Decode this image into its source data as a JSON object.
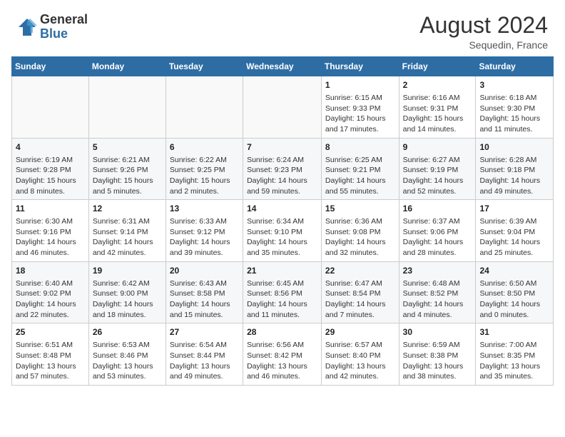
{
  "header": {
    "logo_general": "General",
    "logo_blue": "Blue",
    "month_year": "August 2024",
    "location": "Sequedin, France"
  },
  "calendar": {
    "days_of_week": [
      "Sunday",
      "Monday",
      "Tuesday",
      "Wednesday",
      "Thursday",
      "Friday",
      "Saturday"
    ],
    "weeks": [
      [
        {
          "day": "",
          "empty": true
        },
        {
          "day": "",
          "empty": true
        },
        {
          "day": "",
          "empty": true
        },
        {
          "day": "",
          "empty": true
        },
        {
          "day": "1",
          "lines": [
            "Sunrise: 6:15 AM",
            "Sunset: 9:33 PM",
            "Daylight: 15 hours",
            "and 17 minutes."
          ]
        },
        {
          "day": "2",
          "lines": [
            "Sunrise: 6:16 AM",
            "Sunset: 9:31 PM",
            "Daylight: 15 hours",
            "and 14 minutes."
          ]
        },
        {
          "day": "3",
          "lines": [
            "Sunrise: 6:18 AM",
            "Sunset: 9:30 PM",
            "Daylight: 15 hours",
            "and 11 minutes."
          ]
        }
      ],
      [
        {
          "day": "4",
          "lines": [
            "Sunrise: 6:19 AM",
            "Sunset: 9:28 PM",
            "Daylight: 15 hours",
            "and 8 minutes."
          ]
        },
        {
          "day": "5",
          "lines": [
            "Sunrise: 6:21 AM",
            "Sunset: 9:26 PM",
            "Daylight: 15 hours",
            "and 5 minutes."
          ]
        },
        {
          "day": "6",
          "lines": [
            "Sunrise: 6:22 AM",
            "Sunset: 9:25 PM",
            "Daylight: 15 hours",
            "and 2 minutes."
          ]
        },
        {
          "day": "7",
          "lines": [
            "Sunrise: 6:24 AM",
            "Sunset: 9:23 PM",
            "Daylight: 14 hours",
            "and 59 minutes."
          ]
        },
        {
          "day": "8",
          "lines": [
            "Sunrise: 6:25 AM",
            "Sunset: 9:21 PM",
            "Daylight: 14 hours",
            "and 55 minutes."
          ]
        },
        {
          "day": "9",
          "lines": [
            "Sunrise: 6:27 AM",
            "Sunset: 9:19 PM",
            "Daylight: 14 hours",
            "and 52 minutes."
          ]
        },
        {
          "day": "10",
          "lines": [
            "Sunrise: 6:28 AM",
            "Sunset: 9:18 PM",
            "Daylight: 14 hours",
            "and 49 minutes."
          ]
        }
      ],
      [
        {
          "day": "11",
          "lines": [
            "Sunrise: 6:30 AM",
            "Sunset: 9:16 PM",
            "Daylight: 14 hours",
            "and 46 minutes."
          ]
        },
        {
          "day": "12",
          "lines": [
            "Sunrise: 6:31 AM",
            "Sunset: 9:14 PM",
            "Daylight: 14 hours",
            "and 42 minutes."
          ]
        },
        {
          "day": "13",
          "lines": [
            "Sunrise: 6:33 AM",
            "Sunset: 9:12 PM",
            "Daylight: 14 hours",
            "and 39 minutes."
          ]
        },
        {
          "day": "14",
          "lines": [
            "Sunrise: 6:34 AM",
            "Sunset: 9:10 PM",
            "Daylight: 14 hours",
            "and 35 minutes."
          ]
        },
        {
          "day": "15",
          "lines": [
            "Sunrise: 6:36 AM",
            "Sunset: 9:08 PM",
            "Daylight: 14 hours",
            "and 32 minutes."
          ]
        },
        {
          "day": "16",
          "lines": [
            "Sunrise: 6:37 AM",
            "Sunset: 9:06 PM",
            "Daylight: 14 hours",
            "and 28 minutes."
          ]
        },
        {
          "day": "17",
          "lines": [
            "Sunrise: 6:39 AM",
            "Sunset: 9:04 PM",
            "Daylight: 14 hours",
            "and 25 minutes."
          ]
        }
      ],
      [
        {
          "day": "18",
          "lines": [
            "Sunrise: 6:40 AM",
            "Sunset: 9:02 PM",
            "Daylight: 14 hours",
            "and 22 minutes."
          ]
        },
        {
          "day": "19",
          "lines": [
            "Sunrise: 6:42 AM",
            "Sunset: 9:00 PM",
            "Daylight: 14 hours",
            "and 18 minutes."
          ]
        },
        {
          "day": "20",
          "lines": [
            "Sunrise: 6:43 AM",
            "Sunset: 8:58 PM",
            "Daylight: 14 hours",
            "and 15 minutes."
          ]
        },
        {
          "day": "21",
          "lines": [
            "Sunrise: 6:45 AM",
            "Sunset: 8:56 PM",
            "Daylight: 14 hours",
            "and 11 minutes."
          ]
        },
        {
          "day": "22",
          "lines": [
            "Sunrise: 6:47 AM",
            "Sunset: 8:54 PM",
            "Daylight: 14 hours",
            "and 7 minutes."
          ]
        },
        {
          "day": "23",
          "lines": [
            "Sunrise: 6:48 AM",
            "Sunset: 8:52 PM",
            "Daylight: 14 hours",
            "and 4 minutes."
          ]
        },
        {
          "day": "24",
          "lines": [
            "Sunrise: 6:50 AM",
            "Sunset: 8:50 PM",
            "Daylight: 14 hours",
            "and 0 minutes."
          ]
        }
      ],
      [
        {
          "day": "25",
          "lines": [
            "Sunrise: 6:51 AM",
            "Sunset: 8:48 PM",
            "Daylight: 13 hours",
            "and 57 minutes."
          ]
        },
        {
          "day": "26",
          "lines": [
            "Sunrise: 6:53 AM",
            "Sunset: 8:46 PM",
            "Daylight: 13 hours",
            "and 53 minutes."
          ]
        },
        {
          "day": "27",
          "lines": [
            "Sunrise: 6:54 AM",
            "Sunset: 8:44 PM",
            "Daylight: 13 hours",
            "and 49 minutes."
          ]
        },
        {
          "day": "28",
          "lines": [
            "Sunrise: 6:56 AM",
            "Sunset: 8:42 PM",
            "Daylight: 13 hours",
            "and 46 minutes."
          ]
        },
        {
          "day": "29",
          "lines": [
            "Sunrise: 6:57 AM",
            "Sunset: 8:40 PM",
            "Daylight: 13 hours",
            "and 42 minutes."
          ]
        },
        {
          "day": "30",
          "lines": [
            "Sunrise: 6:59 AM",
            "Sunset: 8:38 PM",
            "Daylight: 13 hours",
            "and 38 minutes."
          ]
        },
        {
          "day": "31",
          "lines": [
            "Sunrise: 7:00 AM",
            "Sunset: 8:35 PM",
            "Daylight: 13 hours",
            "and 35 minutes."
          ]
        }
      ]
    ]
  }
}
